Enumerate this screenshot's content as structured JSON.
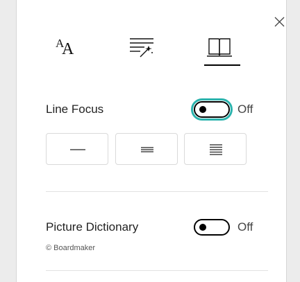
{
  "tabs": [
    {
      "name": "text-preferences",
      "icon": "text-size-icon",
      "glyph_small": "A",
      "glyph_large": "A"
    },
    {
      "name": "grammar-options",
      "icon": "grammar-wand-icon"
    },
    {
      "name": "reading-preferences",
      "icon": "book-icon",
      "selected": true
    }
  ],
  "line_focus": {
    "title": "Line Focus",
    "state": "Off",
    "focus_color": "#2bb3ad",
    "options": [
      {
        "name": "one-line",
        "icon": "one-line-icon"
      },
      {
        "name": "three-lines",
        "icon": "three-lines-icon"
      },
      {
        "name": "five-lines",
        "icon": "five-lines-icon"
      }
    ]
  },
  "picture_dictionary": {
    "title": "Picture Dictionary",
    "state": "Off",
    "credit": "© Boardmaker"
  }
}
